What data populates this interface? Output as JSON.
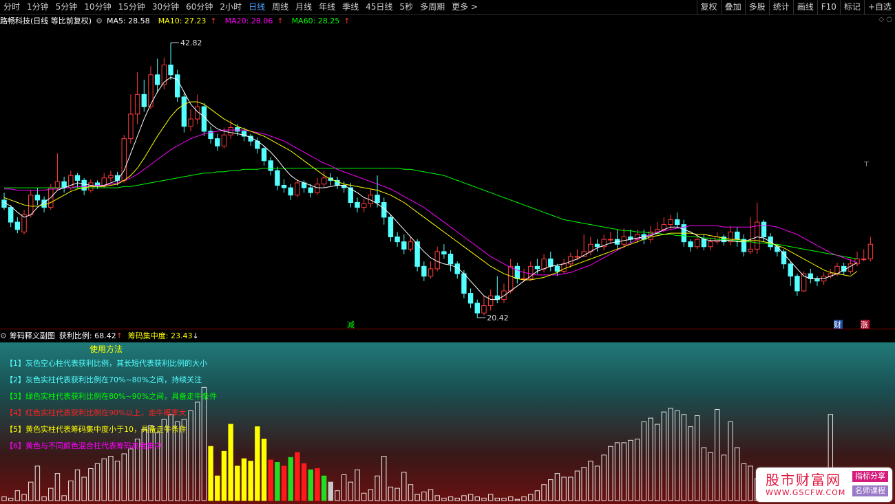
{
  "topbar": {
    "periods": [
      "分时",
      "1分钟",
      "5分钟",
      "10分钟",
      "15分钟",
      "30分钟",
      "60分钟",
      "2小时",
      "日线",
      "周线",
      "月线",
      "年线",
      "季线",
      "45日线",
      "5秒",
      "多周期",
      "更多 >"
    ],
    "active_index": 8,
    "right_items": [
      "复权",
      "叠加",
      "多股",
      "统计",
      "画线",
      "F10",
      "标记",
      "+自选"
    ]
  },
  "infobar": {
    "title": "路畅科技(日线 等比前复权)",
    "ma5_label": "MA5: 28.58",
    "ma10_label": "MA10: 27.23",
    "ma20_label": "MA20: 28.06",
    "ma60_label": "MA60: 28.25",
    "arrow": "↑",
    "tool_icons": "◇ ○"
  },
  "colors": {
    "ma5": "#ffffff",
    "ma10": "#ffff00",
    "ma20": "#ff00ff",
    "ma60": "#00ff00",
    "up": "#ff3b3b",
    "down": "#54ffff"
  },
  "chart_data": {
    "type": "candlestick",
    "price_range": [
      20.42,
      42.82
    ],
    "high_label": "42.82",
    "low_label": "20.42",
    "candles": [
      [
        30.0,
        29.4,
        30.6,
        29.2
      ],
      [
        29.4,
        28.2,
        29.6,
        27.8
      ],
      [
        28.2,
        27.6,
        28.6,
        27.3
      ],
      [
        27.4,
        28.8,
        29.2,
        27.2
      ],
      [
        28.8,
        30.4,
        30.8,
        28.6
      ],
      [
        30.4,
        30.0,
        31.0,
        29.6
      ],
      [
        30.0,
        29.4,
        30.3,
        29.0
      ],
      [
        29.4,
        31.0,
        31.3,
        29.2
      ],
      [
        31.0,
        31.5,
        33.8,
        30.8
      ],
      [
        31.5,
        31.0,
        31.9,
        30.6
      ],
      [
        31.0,
        32.0,
        32.4,
        30.8
      ],
      [
        32.0,
        31.6,
        32.2,
        31.0
      ],
      [
        31.6,
        30.8,
        31.8,
        30.4
      ],
      [
        30.8,
        31.4,
        31.7,
        30.6
      ],
      [
        31.4,
        31.2,
        31.6,
        30.9
      ],
      [
        31.2,
        31.8,
        32.2,
        31.0
      ],
      [
        31.8,
        32.0,
        32.4,
        31.5
      ],
      [
        32.0,
        31.6,
        32.3,
        31.2
      ],
      [
        31.6,
        35.0,
        35.3,
        31.4
      ],
      [
        35.0,
        37.0,
        38.6,
        34.6
      ],
      [
        37.0,
        38.6,
        40.4,
        36.2
      ],
      [
        38.6,
        37.6,
        39.8,
        37.2
      ],
      [
        37.6,
        40.2,
        40.9,
        37.4
      ],
      [
        40.2,
        39.4,
        41.5,
        38.8
      ],
      [
        39.4,
        41.0,
        41.6,
        39.0
      ],
      [
        41.0,
        40.2,
        42.82,
        39.8
      ],
      [
        40.2,
        38.4,
        40.6,
        38.0
      ],
      [
        38.4,
        36.0,
        38.8,
        35.5
      ],
      [
        36.0,
        36.6,
        37.4,
        35.6
      ],
      [
        36.6,
        37.6,
        38.6,
        36.2
      ],
      [
        37.6,
        35.6,
        37.9,
        35.2
      ],
      [
        35.6,
        35.0,
        36.0,
        34.6
      ],
      [
        35.0,
        34.4,
        35.4,
        34.0
      ],
      [
        34.4,
        35.3,
        35.9,
        34.2
      ],
      [
        35.3,
        35.9,
        36.5,
        35.0
      ],
      [
        35.9,
        35.6,
        36.2,
        35.2
      ],
      [
        35.6,
        35.2,
        35.9,
        34.8
      ],
      [
        35.2,
        34.8,
        35.4,
        34.4
      ],
      [
        34.8,
        34.2,
        35.1,
        33.8
      ],
      [
        34.2,
        33.2,
        34.4,
        32.8
      ],
      [
        33.2,
        32.4,
        33.5,
        32.0
      ],
      [
        32.4,
        31.2,
        32.7,
        30.8
      ],
      [
        31.2,
        31.0,
        31.7,
        30.6
      ],
      [
        31.0,
        30.4,
        31.3,
        30.0
      ],
      [
        30.4,
        31.4,
        31.7,
        30.2
      ],
      [
        31.4,
        31.0,
        31.6,
        30.6
      ],
      [
        31.0,
        30.6,
        31.3,
        30.2
      ],
      [
        30.6,
        31.3,
        31.8,
        30.4
      ],
      [
        31.3,
        31.8,
        32.4,
        31.0
      ],
      [
        31.8,
        31.6,
        32.2,
        31.2
      ],
      [
        31.6,
        31.2,
        31.9,
        30.9
      ],
      [
        31.2,
        31.0,
        31.5,
        30.6
      ],
      [
        31.0,
        29.8,
        31.4,
        29.4
      ],
      [
        29.8,
        29.4,
        30.2,
        29.0
      ],
      [
        29.4,
        29.7,
        30.1,
        29.0
      ],
      [
        29.7,
        30.4,
        30.9,
        29.4
      ],
      [
        30.4,
        29.8,
        32.0,
        29.4
      ],
      [
        29.8,
        28.6,
        30.2,
        28.0
      ],
      [
        28.6,
        27.0,
        28.8,
        26.6
      ],
      [
        27.0,
        26.6,
        27.4,
        26.2
      ],
      [
        26.6,
        26.0,
        27.2,
        25.6
      ],
      [
        26.0,
        26.6,
        27.0,
        25.8
      ],
      [
        26.6,
        24.6,
        26.8,
        24.2
      ],
      [
        24.6,
        23.8,
        25.0,
        23.4
      ],
      [
        23.8,
        24.4,
        25.0,
        23.6
      ],
      [
        24.4,
        25.8,
        26.2,
        24.2
      ],
      [
        25.8,
        25.6,
        26.4,
        25.2
      ],
      [
        25.6,
        24.8,
        25.9,
        24.2
      ],
      [
        24.8,
        24.0,
        25.0,
        23.6
      ],
      [
        24.0,
        22.4,
        24.3,
        22.0
      ],
      [
        22.4,
        21.6,
        22.8,
        21.2
      ],
      [
        21.6,
        20.8,
        21.9,
        20.42
      ],
      [
        20.8,
        21.4,
        22.2,
        20.6
      ],
      [
        21.4,
        22.2,
        22.7,
        21.0
      ],
      [
        22.2,
        21.9,
        23.8,
        21.6
      ],
      [
        21.9,
        22.6,
        23.2,
        21.6
      ],
      [
        22.6,
        24.6,
        25.2,
        22.4
      ],
      [
        24.6,
        23.6,
        24.9,
        23.2
      ],
      [
        23.6,
        23.6,
        24.4,
        23.4
      ],
      [
        23.6,
        24.6,
        25.0,
        23.4
      ],
      [
        24.6,
        24.4,
        25.2,
        24.0
      ],
      [
        24.4,
        25.2,
        25.6,
        24.1
      ],
      [
        25.2,
        24.6,
        25.8,
        24.2
      ],
      [
        24.6,
        24.2,
        24.8,
        23.8
      ],
      [
        24.2,
        24.8,
        25.2,
        24.0
      ],
      [
        24.8,
        25.4,
        25.7,
        24.5
      ],
      [
        25.4,
        25.4,
        26.0,
        25.1
      ],
      [
        25.4,
        25.8,
        27.2,
        25.4
      ],
      [
        25.8,
        26.4,
        27.0,
        25.5
      ],
      [
        26.4,
        26.2,
        26.8,
        25.8
      ],
      [
        26.2,
        26.8,
        27.2,
        25.9
      ],
      [
        26.8,
        26.8,
        27.4,
        26.4
      ],
      [
        26.8,
        26.4,
        27.6,
        26.0
      ],
      [
        26.4,
        27.0,
        27.7,
        26.1
      ],
      [
        27.0,
        26.8,
        27.6,
        26.5
      ],
      [
        26.8,
        27.2,
        27.6,
        26.5
      ],
      [
        27.2,
        26.8,
        27.6,
        26.4
      ],
      [
        26.8,
        27.4,
        27.9,
        26.5
      ],
      [
        27.4,
        27.6,
        28.2,
        27.2
      ],
      [
        27.6,
        28.0,
        28.6,
        27.4
      ],
      [
        28.0,
        28.4,
        28.8,
        27.6
      ],
      [
        28.4,
        28.0,
        29.0,
        27.7
      ],
      [
        28.0,
        26.6,
        28.4,
        26.2
      ],
      [
        26.6,
        26.2,
        26.8,
        25.8
      ],
      [
        26.2,
        26.8,
        27.2,
        26.0
      ],
      [
        26.8,
        26.2,
        27.2,
        25.9
      ],
      [
        26.2,
        26.6,
        26.9,
        25.9
      ],
      [
        26.6,
        27.0,
        27.4,
        26.4
      ],
      [
        27.0,
        26.6,
        27.2,
        26.3
      ],
      [
        26.6,
        27.4,
        27.9,
        26.3
      ],
      [
        27.4,
        26.8,
        27.8,
        26.2
      ],
      [
        26.8,
        25.8,
        27.2,
        25.4
      ],
      [
        25.8,
        26.0,
        28.6,
        25.6
      ],
      [
        26.0,
        28.2,
        29.8,
        25.6
      ],
      [
        28.2,
        27.0,
        28.4,
        26.6
      ],
      [
        27.0,
        26.2,
        27.3,
        25.9
      ],
      [
        26.2,
        25.8,
        26.4,
        25.4
      ],
      [
        25.8,
        24.8,
        26.0,
        24.4
      ],
      [
        24.8,
        23.8,
        25.0,
        23.0
      ],
      [
        23.8,
        22.6,
        24.0,
        22.2
      ],
      [
        22.6,
        24.0,
        24.2,
        22.5
      ],
      [
        24.0,
        23.6,
        24.4,
        23.2
      ],
      [
        23.6,
        23.4,
        23.8,
        23.0
      ],
      [
        23.4,
        23.8,
        24.1,
        23.1
      ],
      [
        23.8,
        24.0,
        24.4,
        23.6
      ],
      [
        24.0,
        24.6,
        24.9,
        23.8
      ],
      [
        24.6,
        24.2,
        24.9,
        23.9
      ],
      [
        24.2,
        24.8,
        25.2,
        24.0
      ],
      [
        24.8,
        25.2,
        25.8,
        24.6
      ],
      [
        25.2,
        25.2,
        26.0,
        25.0
      ],
      [
        25.2,
        26.4,
        27.0,
        25.0
      ]
    ],
    "ma5": [
      29.8,
      29.5,
      29.0,
      28.6,
      28.8,
      29.4,
      29.8,
      30.2,
      30.8,
      31.0,
      31.2,
      31.4,
      31.3,
      31.2,
      31.1,
      31.2,
      31.4,
      31.6,
      32.4,
      33.8,
      35.2,
      36.6,
      37.8,
      38.8,
      39.6,
      40.0,
      39.8,
      38.8,
      37.8,
      37.2,
      36.8,
      36.2,
      35.8,
      35.6,
      35.5,
      35.4,
      35.3,
      35.1,
      34.8,
      34.4,
      33.9,
      33.3,
      32.6,
      32.0,
      31.6,
      31.4,
      31.2,
      31.0,
      31.0,
      31.1,
      31.2,
      31.2,
      30.9,
      30.6,
      30.2,
      30.0,
      29.7,
      29.3,
      28.8,
      28.2,
      27.6,
      27.0,
      26.4,
      25.8,
      25.3,
      25.0,
      24.8,
      24.7,
      24.5,
      24.0,
      23.4,
      22.8,
      22.2,
      21.9,
      21.9,
      22.2,
      22.6,
      23.0,
      23.4,
      23.8,
      24.2,
      24.4,
      24.6,
      24.7,
      24.8,
      25.0,
      25.2,
      25.5,
      25.8,
      26.1,
      26.3,
      26.5,
      26.6,
      26.7,
      26.8,
      26.9,
      27.0,
      27.1,
      27.3,
      27.6,
      27.8,
      27.8,
      27.6,
      27.4,
      27.1,
      26.8,
      26.7,
      26.7,
      26.7,
      26.7,
      26.6,
      26.6,
      26.8,
      27.0,
      26.9,
      26.6,
      26.2,
      25.6,
      25.0,
      24.4,
      23.8,
      23.6,
      23.6,
      23.6,
      23.8,
      24.0,
      24.3,
      24.6,
      24.9
    ],
    "ma10": [
      30.2,
      30.0,
      29.8,
      29.6,
      29.5,
      29.5,
      29.6,
      29.8,
      30.1,
      30.4,
      30.7,
      30.9,
      31.0,
      31.1,
      31.1,
      31.1,
      31.2,
      31.3,
      31.6,
      32.0,
      32.6,
      33.4,
      34.3,
      35.2,
      36.0,
      36.8,
      37.4,
      37.8,
      38.0,
      38.0,
      37.8,
      37.4,
      37.0,
      36.6,
      36.3,
      36.0,
      35.8,
      35.6,
      35.4,
      35.2,
      34.9,
      34.6,
      34.3,
      34.0,
      33.6,
      33.2,
      32.8,
      32.4,
      32.0,
      31.7,
      31.5,
      31.3,
      31.2,
      31.1,
      31.0,
      30.9,
      30.8,
      30.6,
      30.4,
      30.1,
      29.8,
      29.4,
      29.0,
      28.6,
      28.2,
      27.8,
      27.4,
      27.0,
      26.6,
      26.2,
      25.8,
      25.4,
      25.0,
      24.6,
      24.3,
      24.0,
      23.8,
      23.6,
      23.5,
      23.5,
      23.6,
      23.7,
      23.9,
      24.1,
      24.4,
      24.6,
      24.8,
      25.0,
      25.2,
      25.4,
      25.6,
      25.8,
      26.0,
      26.2,
      26.4,
      26.6,
      26.8,
      27.0,
      27.1,
      27.2,
      27.3,
      27.3,
      27.3,
      27.3,
      27.2,
      27.2,
      27.1,
      27.0,
      26.9,
      26.8,
      26.8,
      26.7,
      26.7,
      26.7,
      26.6,
      26.5,
      26.3,
      26.1,
      25.8,
      25.5,
      25.2,
      24.9,
      24.6,
      24.3,
      24.1,
      24.0,
      23.9,
      23.8,
      24.2
    ]
  },
  "labels": {
    "ma20": [
      30.9,
      30.9,
      30.8,
      30.8,
      30.8,
      30.8,
      30.8,
      30.9,
      30.9,
      31.0,
      31.0,
      31.1,
      31.1,
      31.1,
      31.2,
      31.2,
      31.3,
      31.4,
      31.6,
      31.8,
      32.1,
      32.5,
      32.9,
      33.3,
      33.7,
      34.1,
      34.4,
      34.7,
      35.0,
      35.2,
      35.4,
      35.5,
      35.6,
      35.7,
      35.7,
      35.7,
      35.7,
      35.6,
      35.5,
      35.4,
      35.2,
      35.0,
      34.8,
      34.5,
      34.2,
      33.9,
      33.6,
      33.3,
      33.0,
      32.8,
      32.5,
      32.3,
      32.1,
      31.9,
      31.7,
      31.5,
      31.3,
      31.1,
      30.9,
      30.6,
      30.3,
      30.0,
      29.7,
      29.4,
      29.0,
      28.6,
      28.2,
      27.8,
      27.4,
      27.0,
      26.6,
      26.2,
      25.8,
      25.4,
      25.1,
      24.8,
      24.5,
      24.3,
      24.1,
      24.0,
      23.9,
      23.9,
      23.9,
      23.9,
      24.0,
      24.1,
      24.3,
      24.5,
      24.7,
      25.0,
      25.3,
      25.6,
      25.9,
      26.2,
      26.5,
      26.8,
      27.0,
      27.2,
      27.4,
      27.5,
      27.6,
      27.7,
      27.8,
      27.9,
      27.9,
      27.9,
      27.9,
      27.9,
      27.8,
      27.8,
      27.8,
      27.8,
      27.8,
      27.9,
      27.9,
      27.9,
      27.8,
      27.6,
      27.4,
      27.2,
      26.9,
      26.6,
      26.3,
      26.0,
      25.7,
      25.5,
      25.3,
      25.1,
      24.9
    ],
    "ma60": [
      31.0,
      31.0,
      31.0,
      31.0,
      31.0,
      31.0,
      31.0,
      31.0,
      31.0,
      31.0,
      31.0,
      31.0,
      31.0,
      31.0,
      31.0,
      31.0,
      31.0,
      31.0,
      31.1,
      31.1,
      31.2,
      31.3,
      31.4,
      31.5,
      31.6,
      31.7,
      31.8,
      31.9,
      32.0,
      32.1,
      32.2,
      32.2,
      32.3,
      32.3,
      32.4,
      32.4,
      32.5,
      32.5,
      32.5,
      32.6,
      32.6,
      32.6,
      32.6,
      32.6,
      32.6,
      32.6,
      32.6,
      32.6,
      32.6,
      32.6,
      32.6,
      32.6,
      32.6,
      32.6,
      32.6,
      32.6,
      32.6,
      32.6,
      32.6,
      32.6,
      32.5,
      32.5,
      32.4,
      32.3,
      32.2,
      32.1,
      32.0,
      31.8,
      31.6,
      31.4,
      31.2,
      31.0,
      30.8,
      30.6,
      30.4,
      30.2,
      30.0,
      29.8,
      29.6,
      29.4,
      29.2,
      29.0,
      28.8,
      28.6,
      28.4,
      28.3,
      28.2,
      28.1,
      28.0,
      27.9,
      27.8,
      27.7,
      27.6,
      27.5,
      27.5,
      27.4,
      27.4,
      27.3,
      27.3,
      27.2,
      27.2,
      27.1,
      27.1,
      27.0,
      27.0,
      26.9,
      26.9,
      26.8,
      26.8,
      26.7,
      26.7,
      26.6,
      26.6,
      26.5,
      26.5,
      26.4,
      26.4,
      26.3,
      26.2,
      26.1,
      26.0,
      25.9,
      25.8,
      25.7,
      25.6,
      25.5,
      25.4,
      25.3,
      25.2
    ]
  },
  "markers": {
    "jian": "减",
    "cai": "财",
    "zhang": "涨"
  },
  "subinfo": {
    "title": "筹码释义副图",
    "profit_label": "获利比例: 68.42",
    "profit_arrow": "↑",
    "conc_label": "筹码集中度: 23.43",
    "conc_arrow": "↓"
  },
  "sub_chart": {
    "bars": [
      3,
      2,
      8,
      5,
      15,
      28,
      3,
      10,
      22,
      4,
      16,
      25,
      19,
      26,
      30,
      34,
      36,
      32,
      38,
      42,
      50,
      58,
      61,
      55,
      66,
      70,
      64,
      66,
      73,
      80,
      92,
      44,
      20,
      40,
      62,
      28,
      34,
      32,
      60,
      50,
      33,
      31,
      28,
      35,
      39,
      30,
      25,
      26,
      20,
      15,
      8,
      21,
      15,
      25,
      6,
      9,
      20,
      36,
      11,
      10,
      23,
      13,
      5,
      7,
      9,
      4,
      2,
      3,
      2,
      4,
      5,
      3,
      2,
      5,
      2,
      2,
      3,
      1,
      3,
      5,
      8,
      13,
      17,
      22,
      19,
      19,
      24,
      27,
      32,
      28,
      37,
      44,
      47,
      47,
      49,
      50,
      64,
      67,
      62,
      72,
      75,
      73,
      70,
      60,
      69,
      43,
      39,
      74,
      37,
      64,
      43,
      30,
      28,
      18,
      11,
      10,
      6,
      6,
      4,
      3,
      6,
      3,
      3,
      26,
      70
    ],
    "colors": "bbbbbbbbbbbbbbbbbbbbbbbbbbbbbbbyyyyyyyyyrgrgrrgrgwbbbbbbbbbbbbbbbbbbbbbbbbbbbbbbbbbbbbbbbbbbbbbbbbbbbbbbbbbbbbbbbbbbbbbbbbbbbbbbbbbbbbbbbb",
    "method_title": "使用方法",
    "methods": [
      {
        "text": "【1】灰色空心柱代表获利比例，其长短代表获利比例的大小",
        "color": "#54ffff"
      },
      {
        "text": "【2】灰色实柱代表获利比例在70%~80%之间，持续关注",
        "color": "#54ffff"
      },
      {
        "text": "【3】绿色实柱代表获利比例在80%~90%之间，具备走牛条件",
        "color": "#00ff00"
      },
      {
        "text": "【4】红色实柱代表获利比例在90%以上，走牛概率大",
        "color": "#ff2020"
      },
      {
        "text": "【5】黄色实柱代表筹码集中度小于10，具备走牛条件",
        "color": "#ffff00"
      },
      {
        "text": "【6】黄色与不同颜色混合柱代表筹码高度集中",
        "color": "#ff00ff"
      }
    ]
  },
  "watermark": {
    "big": "股市财富网",
    "url": "WWW.GSCFW.COM",
    "tag1": "指标分享",
    "tag2": "名师课程"
  }
}
